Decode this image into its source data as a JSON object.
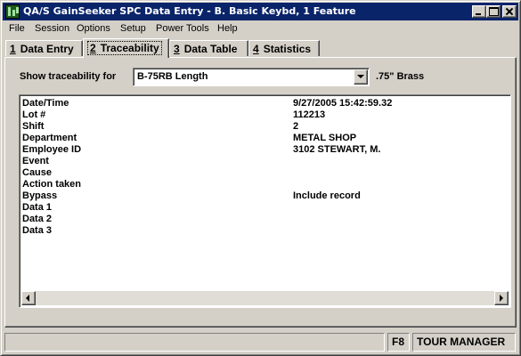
{
  "window": {
    "title": "QA/S GainSeeker SPC Data Entry - B. Basic Keybd, 1 Feature"
  },
  "menu": [
    "File",
    "Session",
    "Options",
    "Setup",
    "Power Tools",
    "Help"
  ],
  "tabs": [
    {
      "num": "1",
      "label": "Data Entry",
      "active": false
    },
    {
      "num": "2",
      "label": "Traceability",
      "active": true
    },
    {
      "num": "3",
      "label": "Data Table",
      "active": false
    },
    {
      "num": "4",
      "label": "Statistics",
      "active": false
    }
  ],
  "traceability": {
    "show_label": "Show traceability for",
    "selected_feature": "B-75RB Length",
    "material": ".75\" Brass"
  },
  "records": [
    {
      "field": "Date/Time",
      "value": "9/27/2005 15:42:59.32"
    },
    {
      "field": "Lot #",
      "value": "112213"
    },
    {
      "field": "Shift",
      "value": "2"
    },
    {
      "field": "Department",
      "value": "METAL SHOP"
    },
    {
      "field": "Employee ID",
      "value": "3102 STEWART, M."
    },
    {
      "field": "Event",
      "value": ""
    },
    {
      "field": "Cause",
      "value": ""
    },
    {
      "field": "Action taken",
      "value": ""
    },
    {
      "field": "Bypass",
      "value": "Include record"
    },
    {
      "field": "Data 1",
      "value": ""
    },
    {
      "field": "Data 2",
      "value": ""
    },
    {
      "field": "Data 3",
      "value": ""
    }
  ],
  "status": {
    "main": "",
    "key": "F8",
    "user": "TOUR MANAGER"
  }
}
